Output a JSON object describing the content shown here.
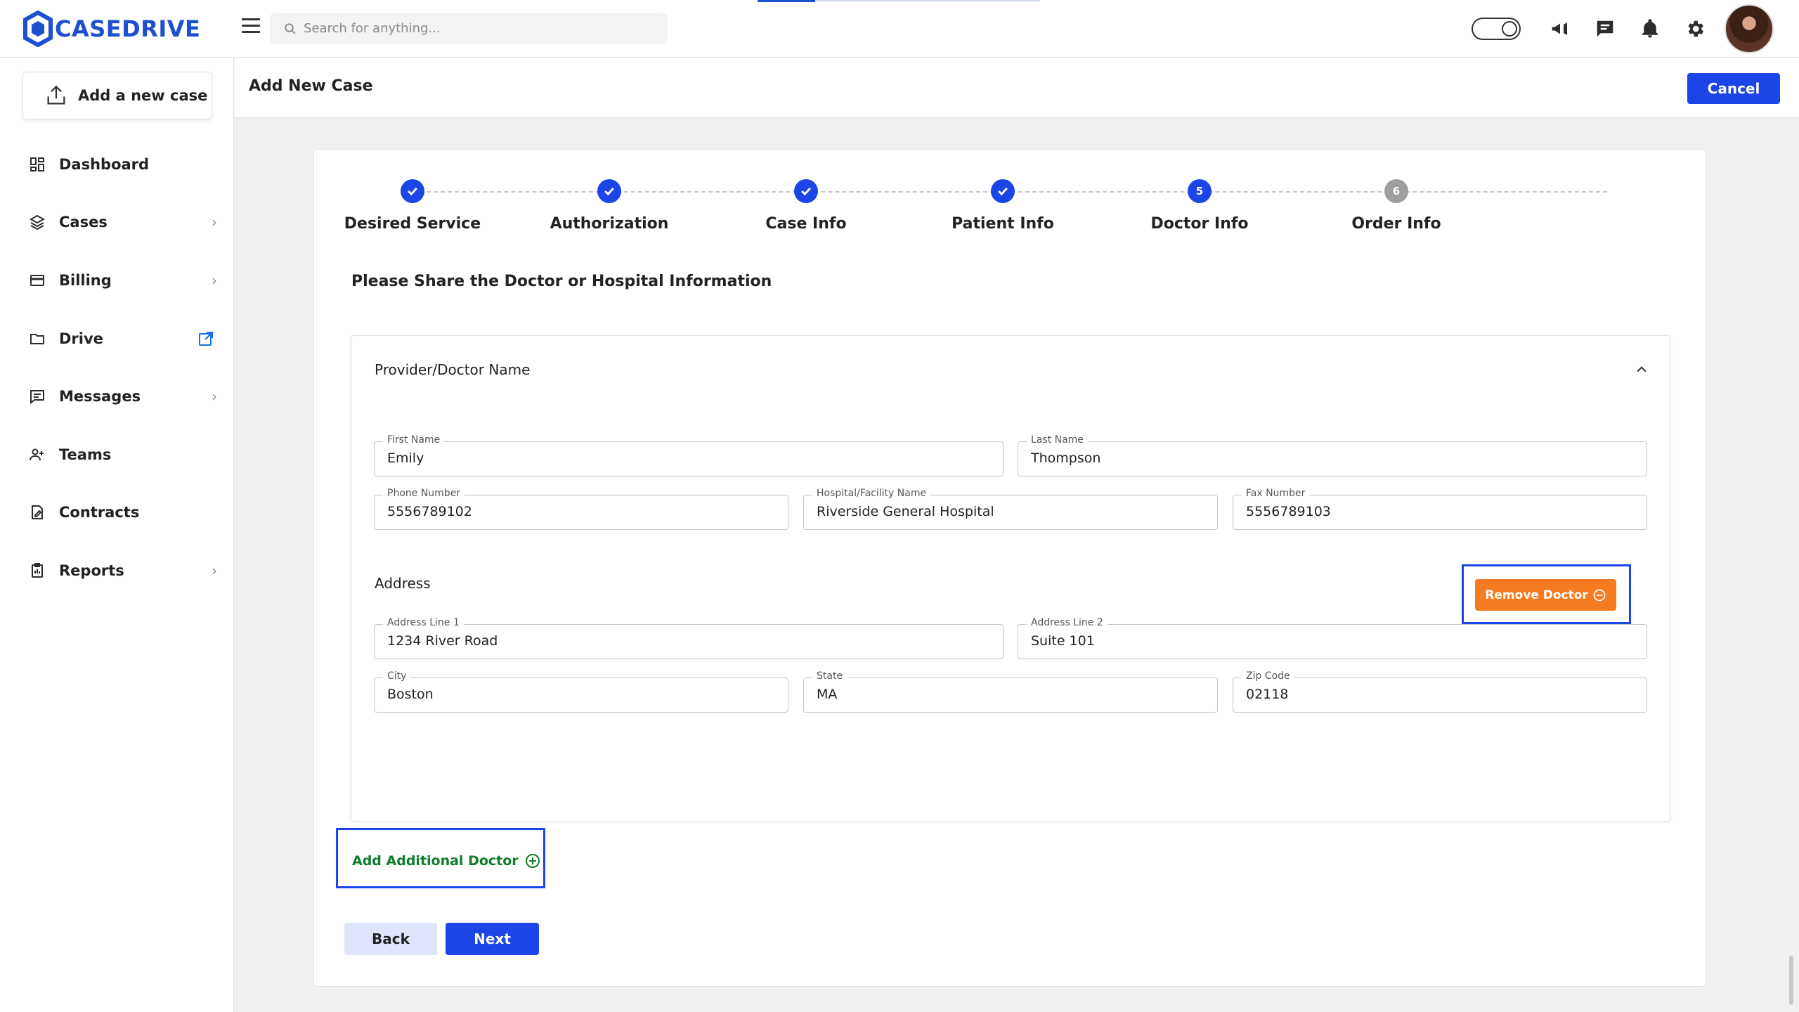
{
  "app": {
    "brand": "CASEDRIVE"
  },
  "search": {
    "placeholder": "Search for anything..."
  },
  "sidebar": {
    "add_case_label": "Add a new case",
    "items": [
      {
        "label": "Dashboard",
        "icon": "dashboard-icon",
        "chevron": false
      },
      {
        "label": "Cases",
        "icon": "layers-icon",
        "chevron": true
      },
      {
        "label": "Billing",
        "icon": "credit-card-icon",
        "chevron": true
      },
      {
        "label": "Drive",
        "icon": "folder-icon",
        "chevron": false,
        "external": true
      },
      {
        "label": "Messages",
        "icon": "message-icon",
        "chevron": true
      },
      {
        "label": "Teams",
        "icon": "users-icon",
        "chevron": false
      },
      {
        "label": "Contracts",
        "icon": "contract-icon",
        "chevron": false
      },
      {
        "label": "Reports",
        "icon": "clipboard-icon",
        "chevron": true
      }
    ]
  },
  "header": {
    "title": "Add New Case",
    "cancel_label": "Cancel"
  },
  "stepper": {
    "steps": [
      {
        "label": "Desired Service",
        "status": "done",
        "number": "1"
      },
      {
        "label": "Authorization",
        "status": "done",
        "number": "2"
      },
      {
        "label": "Case Info",
        "status": "done",
        "number": "3"
      },
      {
        "label": "Patient Info",
        "status": "done",
        "number": "4"
      },
      {
        "label": "Doctor Info",
        "status": "current",
        "number": "5"
      },
      {
        "label": "Order Info",
        "status": "pending",
        "number": "6"
      }
    ]
  },
  "form": {
    "subtitle": "Please Share the Doctor or Hospital Information",
    "panel_title": "Provider/Doctor Name",
    "fields": {
      "first_name": {
        "label": "First Name",
        "value": "Emily"
      },
      "last_name": {
        "label": "Last Name",
        "value": "Thompson"
      },
      "phone": {
        "label": "Phone Number",
        "value": "5556789102"
      },
      "hospital": {
        "label": "Hospital/Facility Name",
        "value": "Riverside General Hospital"
      },
      "fax": {
        "label": "Fax Number",
        "value": "5556789103"
      },
      "address1": {
        "label": "Address Line 1",
        "value": "1234 River Road"
      },
      "address2": {
        "label": "Address Line 2",
        "value": "Suite 101"
      },
      "city": {
        "label": "City",
        "value": "Boston"
      },
      "state": {
        "label": "State",
        "value": "MA"
      },
      "zip": {
        "label": "Zip Code",
        "value": "02118"
      }
    },
    "address_title": "Address",
    "remove_label": "Remove Doctor",
    "add_label": "Add Additional Doctor",
    "back_label": "Back",
    "next_label": "Next"
  },
  "colors": {
    "primary": "#1b45e6",
    "danger": "#f47b20",
    "add": "#0d7d2a"
  }
}
